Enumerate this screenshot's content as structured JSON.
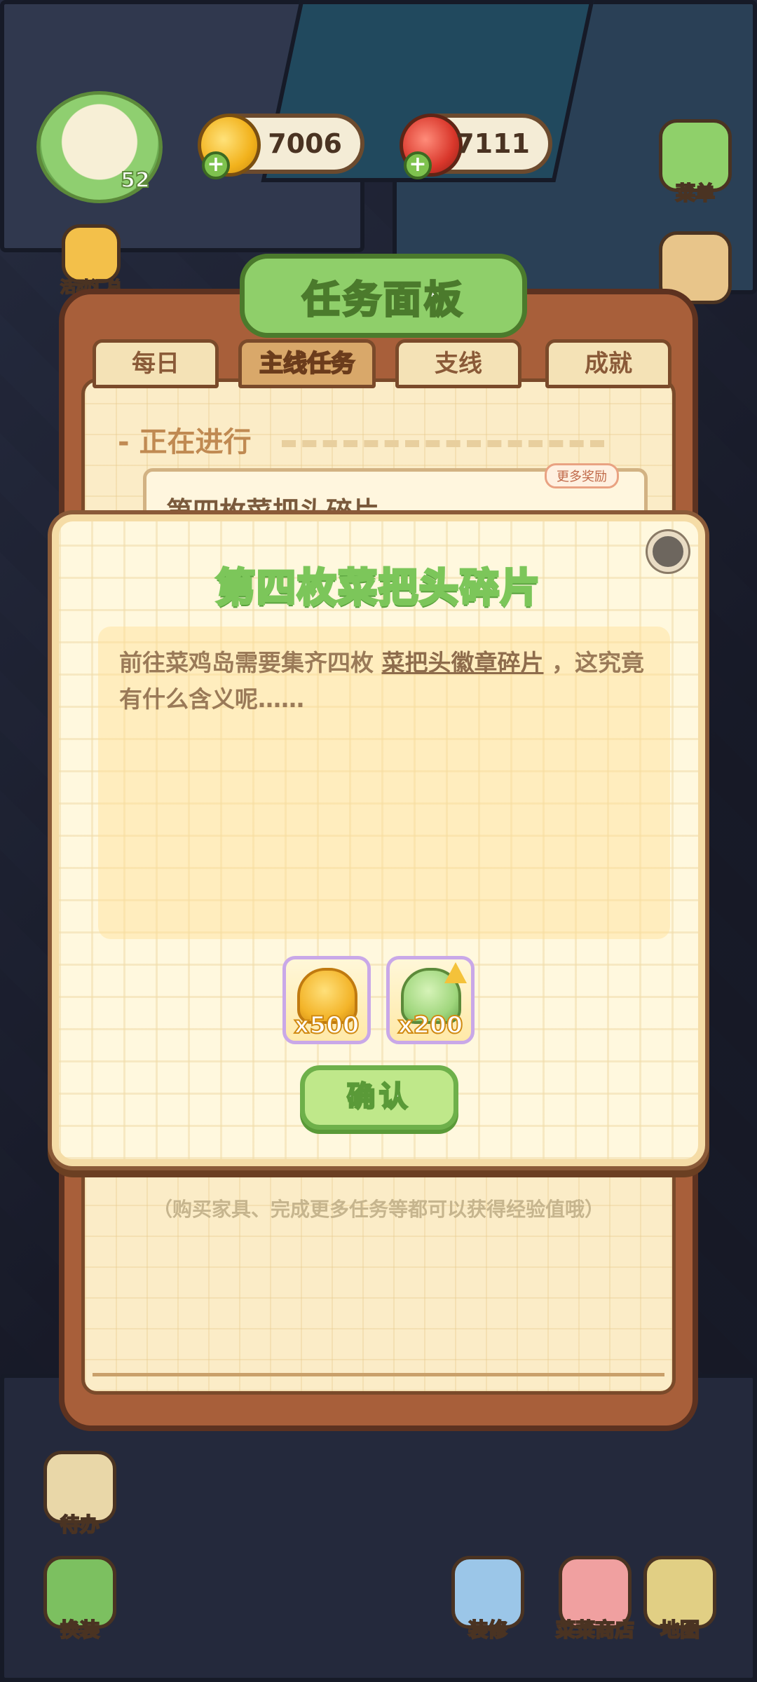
{
  "hud": {
    "level": "52",
    "coins": "7006",
    "food": "7111",
    "menu_label": "菜单",
    "event_label": "活动汇总"
  },
  "quest_panel": {
    "title": "任务面板",
    "tabs": [
      "每日",
      "主线任务",
      "支线",
      "成就"
    ],
    "active_tab": "主线任务",
    "section_heading": "- 正在进行",
    "current_quest": "第四枚菜把头碎片",
    "more_reward_badge": "更多奖励",
    "hint": "（购买家具、完成更多任务等都可以获得经验值哦）"
  },
  "dialog": {
    "title": "第四枚菜把头碎片",
    "desc_before": "前往菜鸡岛需要集齐四枚 ",
    "desc_link": "菜把头徽章碎片",
    "desc_after": " ，这究竟有什么含义呢……",
    "rewards": [
      {
        "icon": "coin-pile-icon",
        "qty": "x500"
      },
      {
        "icon": "vegetable-exp-icon",
        "qty": "x200"
      }
    ],
    "confirm_label": "确认"
  },
  "bottom_nav": {
    "todo": "待办",
    "dress": "换装",
    "decorate": "装修",
    "shop": "菜菜商店",
    "map": "地图"
  }
}
